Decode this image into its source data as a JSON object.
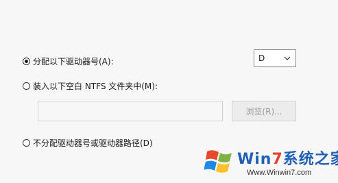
{
  "options": {
    "assign_letter": {
      "label": "分配以下驱动器号(A):",
      "checked": true
    },
    "mount_folder": {
      "label": "装入以下空白 NTFS 文件夹中(M):",
      "checked": false
    },
    "no_letter": {
      "label": "不分配驱动器号或驱动器路径(D)",
      "checked": false
    }
  },
  "drive_letter": {
    "value": "D",
    "icon": "chevron-down-icon"
  },
  "folder_path": {
    "value": "",
    "disabled": true
  },
  "browse_button": {
    "label": "浏览(R)...",
    "disabled": true
  },
  "watermark": {
    "brand_part1": "Win",
    "brand_part2": "7",
    "brand_part3": "系统之家",
    "url": "Www.Winwin7.com",
    "icon": "windows-logo-icon"
  },
  "colors": {
    "background": "#f7f7f7",
    "disabled_text": "#9d9d9d",
    "watermark_blue": "#1f5fb5",
    "watermark_red": "#e4412b"
  }
}
